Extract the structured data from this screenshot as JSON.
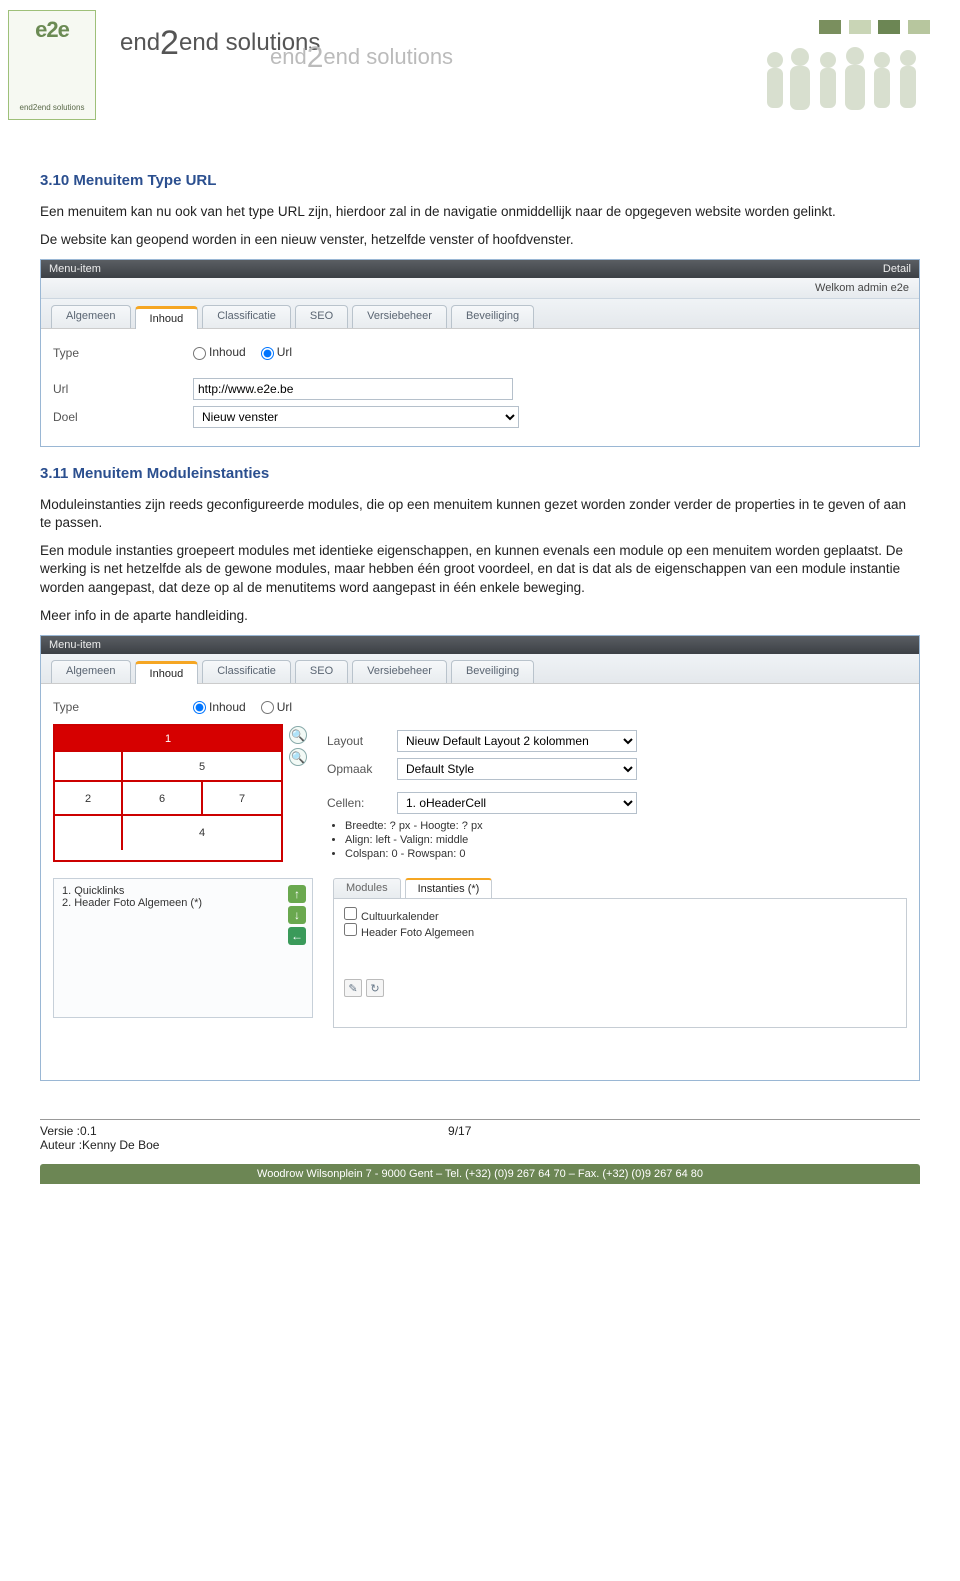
{
  "header": {
    "logo_top": "e2e",
    "logo_bottom": "end2end solutions",
    "brand1_a": "end",
    "brand1_b": "2",
    "brand1_c": "end solutions",
    "brand2_a": "end",
    "brand2_b": "2",
    "brand2_c": "end solutions",
    "box_colors": [
      "#7a8f5e",
      "#c9d5b6",
      "#6c8654",
      "#b7c69e"
    ]
  },
  "section1": {
    "heading": "3.10 Menuitem Type URL",
    "p1": "Een menuitem kan nu ook van het type URL zijn, hierdoor zal in de navigatie onmiddellijk naar de opgegeven website worden gelinkt.",
    "p2": "De website kan geopend worden in een nieuw venster, hetzelfde venster of hoofdvenster."
  },
  "shot1": {
    "titlebar_left": "Menu-item",
    "titlebar_right": "Detail",
    "welcome": "Welkom admin e2e",
    "tabs": [
      "Algemeen",
      "Inhoud",
      "Classificatie",
      "SEO",
      "Versiebeheer",
      "Beveiliging"
    ],
    "active_tab": 1,
    "type_label": "Type",
    "type_opt1": "Inhoud",
    "type_opt2": "Url",
    "type_selected": "Url",
    "url_label": "Url",
    "url_value": "http://www.e2e.be",
    "doel_label": "Doel",
    "doel_value": "Nieuw venster"
  },
  "section2": {
    "heading": "3.11 Menuitem Moduleinstanties",
    "p1": "Moduleinstanties zijn reeds geconfigureerde modules, die op een menuitem kunnen gezet worden zonder verder de properties in te geven of aan te passen.",
    "p2": "Een module instanties groepeert modules met identieke eigenschappen, en kunnen evenals een module op een menuitem worden geplaatst. De werking is net hetzelfde als de gewone modules, maar hebben één groot voordeel, en dat is dat als de eigenschappen van een module instantie worden aangepast, dat deze op al de menutitems word aangepast in één enkele beweging.",
    "p3": "Meer info in de aparte handleiding."
  },
  "shot2": {
    "titlebar_left": "Menu-item",
    "tabs": [
      "Algemeen",
      "Inhoud",
      "Classificatie",
      "SEO",
      "Versiebeheer",
      "Beveiliging"
    ],
    "active_tab": 1,
    "type_label": "Type",
    "type_opt1": "Inhoud",
    "type_opt2": "Url",
    "type_selected": "Inhoud",
    "grid": {
      "c1": "1",
      "c2": "2",
      "c4": "4",
      "c5": "5",
      "c6": "6",
      "c7": "7"
    },
    "layout_label": "Layout",
    "layout_value": "Nieuw Default Layout 2 kolommen",
    "opmaak_label": "Opmaak",
    "opmaak_value": "Default Style",
    "cellen_label": "Cellen:",
    "cellen_value": "1. oHeaderCell",
    "bullets": [
      "Breedte: ? px - Hoogte: ? px",
      "Align: left - Valign: middle",
      "Colspan: 0 - Rowspan: 0"
    ],
    "left_items": [
      "1. Quicklinks",
      "2. Header Foto Algemeen (*)"
    ],
    "subtabs": [
      "Modules",
      "Instanties (*)"
    ],
    "subtab_active": 1,
    "instances": [
      "Cultuurkalender",
      "Header Foto Algemeen"
    ]
  },
  "footer": {
    "versie_label": "Versie  :",
    "versie_value": "0.1",
    "page": "9/17",
    "auteur_label": "Auteur :",
    "auteur_value": "Kenny De Boe",
    "bar": "Woodrow Wilsonplein 7 - 9000 Gent – Tel. (+32) (0)9 267 64 70 – Fax. (+32) (0)9 267 64 80"
  }
}
